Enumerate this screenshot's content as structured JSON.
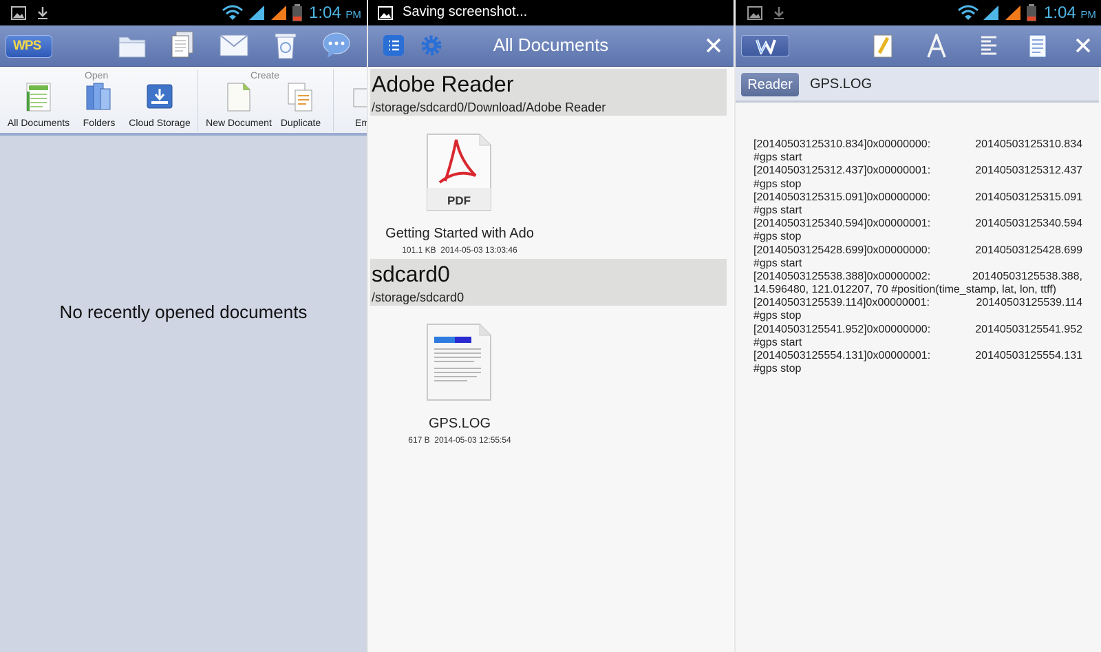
{
  "screen1": {
    "status_time": "1:04",
    "status_ampm": "PM",
    "logo_text": "WPS",
    "ribbon": {
      "open_label": "Open",
      "create_label": "Create",
      "items": [
        {
          "label": "All Documents"
        },
        {
          "label": "Folders"
        },
        {
          "label": "Cloud Storage"
        },
        {
          "label": "New Document"
        },
        {
          "label": "Duplicate"
        },
        {
          "label": "Em"
        }
      ]
    },
    "empty_message": "No recently opened documents"
  },
  "screen2": {
    "status_text": "Saving screenshot...",
    "title": "All Documents",
    "sections": [
      {
        "name": "Adobe Reader",
        "path": "/storage/sdcard0/Download/Adobe Reader",
        "file": {
          "name": "Getting Started with Ado",
          "size": "101.1 KB",
          "date": "2014-05-03 13:03:46",
          "icon_text": "PDF"
        }
      },
      {
        "name": "sdcard0",
        "path": "/storage/sdcard0",
        "file": {
          "name": "GPS.LOG",
          "size": "617 B",
          "date": "2014-05-03 12:55:54"
        }
      }
    ]
  },
  "screen3": {
    "status_time": "1:04",
    "status_ampm": "PM",
    "reader_label": "Reader",
    "doc_title": "GPS.LOG",
    "log_lines": [
      {
        "a": "[20140503125310.834]0x00000000:",
        "b": "20140503125310.834"
      },
      {
        "a": "#gps start",
        "b": ""
      },
      {
        "a": "[20140503125312.437]0x00000001:",
        "b": "20140503125312.437"
      },
      {
        "a": "#gps stop",
        "b": ""
      },
      {
        "a": "[20140503125315.091]0x00000000:",
        "b": "20140503125315.091"
      },
      {
        "a": "#gps start",
        "b": ""
      },
      {
        "a": "[20140503125340.594]0x00000001:",
        "b": "20140503125340.594"
      },
      {
        "a": "#gps stop",
        "b": ""
      },
      {
        "a": "[20140503125428.699]0x00000000:",
        "b": "20140503125428.699"
      },
      {
        "a": "#gps start",
        "b": ""
      },
      {
        "a": "[20140503125538.388]0x00000002:",
        "b": "20140503125538.388,"
      },
      {
        "a": "14.596480, 121.012207, 70 #position(time_stamp, lat, lon, ttff)",
        "b": ""
      },
      {
        "a": "[20140503125539.114]0x00000001:",
        "b": "20140503125539.114"
      },
      {
        "a": "#gps stop",
        "b": ""
      },
      {
        "a": "[20140503125541.952]0x00000000:",
        "b": "20140503125541.952"
      },
      {
        "a": "#gps start",
        "b": ""
      },
      {
        "a": "[20140503125554.131]0x00000001:",
        "b": "20140503125554.131"
      },
      {
        "a": "#gps stop",
        "b": ""
      }
    ]
  },
  "colors": {
    "toolbar": "#6b82b8",
    "status_accent": "#4fb6e8",
    "pdf_red": "#d9272e"
  }
}
